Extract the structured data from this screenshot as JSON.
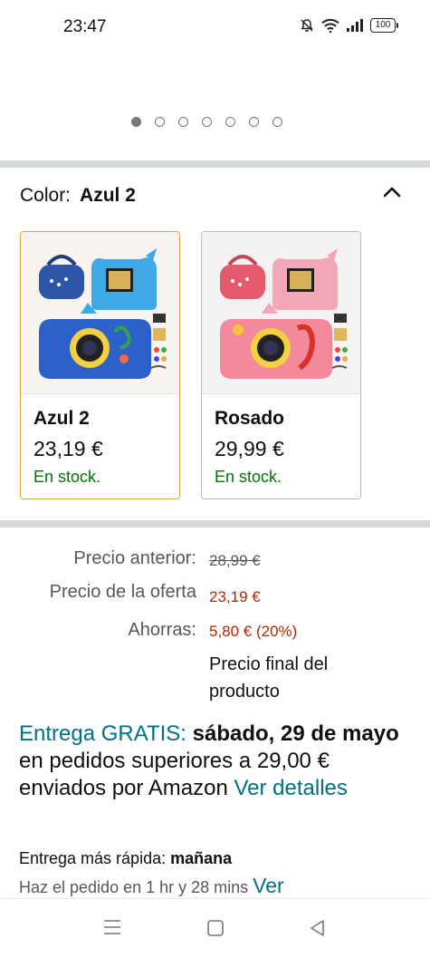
{
  "status": {
    "time": "23:47",
    "battery": "100"
  },
  "carousel": {
    "count": 7,
    "active_index": 0
  },
  "color_selector": {
    "label": "Color:",
    "selected": "Azul 2"
  },
  "variants": [
    {
      "name": "Azul 2",
      "price": "23,19 €",
      "stock": "En stock.",
      "selected": true
    },
    {
      "name": "Rosado",
      "price": "29,99 €",
      "stock": "En stock.",
      "selected": false
    }
  ],
  "pricing": {
    "previous_label": "Precio anterior:",
    "previous_value": "28,99 €",
    "offer_label": "Precio de la oferta",
    "offer_value": "23,19 €",
    "savings_label": "Ahorras:",
    "savings_value": "5,80 € (20%)",
    "final_note": "Precio final del producto"
  },
  "delivery": {
    "free_label": "Entrega GRATIS:",
    "date": "sábado, 29 de mayo",
    "condition": "en pedidos superiores a 29,00 € enviados por Amazon",
    "details_link": "Ver detalles"
  },
  "fast_delivery": {
    "label": "Entrega más rápida:",
    "value": "mañana"
  },
  "order_by": {
    "text": "Haz el pedido en 1 hr y 28 mins",
    "link": "Ver"
  },
  "colors": {
    "link": "#007185",
    "price_red": "#b12704",
    "in_stock": "#007600",
    "selected_border": "#e3a340"
  }
}
